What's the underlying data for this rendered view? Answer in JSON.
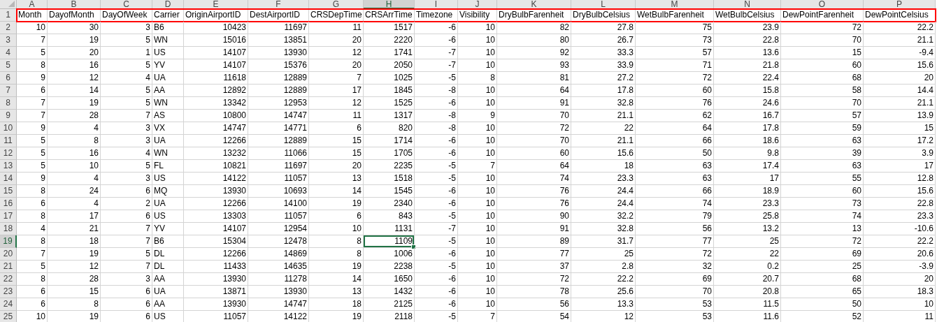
{
  "columns": [
    {
      "letter": "A",
      "kind": "number",
      "selected": false
    },
    {
      "letter": "B",
      "kind": "number",
      "selected": false
    },
    {
      "letter": "C",
      "kind": "number",
      "selected": false
    },
    {
      "letter": "D",
      "kind": "text",
      "selected": false
    },
    {
      "letter": "E",
      "kind": "number",
      "selected": false
    },
    {
      "letter": "F",
      "kind": "number",
      "selected": false
    },
    {
      "letter": "G",
      "kind": "number",
      "selected": false
    },
    {
      "letter": "H",
      "kind": "number",
      "selected": true
    },
    {
      "letter": "I",
      "kind": "number",
      "selected": false
    },
    {
      "letter": "J",
      "kind": "number",
      "selected": false
    },
    {
      "letter": "K",
      "kind": "number",
      "selected": false
    },
    {
      "letter": "L",
      "kind": "number",
      "selected": false
    },
    {
      "letter": "M",
      "kind": "number",
      "selected": false
    },
    {
      "letter": "N",
      "kind": "number",
      "selected": false
    },
    {
      "letter": "O",
      "kind": "number",
      "selected": false
    },
    {
      "letter": "P",
      "kind": "number",
      "selected": false
    }
  ],
  "rows": [
    {
      "number": "1",
      "kind": "header",
      "selected": false,
      "highlighted": true,
      "cells": [
        "Month",
        "DayofMonth",
        "DayOfWeek",
        "Carrier",
        "OriginAirportID",
        "DestAirportID",
        "CRSDepTime",
        "CRSArrTime",
        "Timezone",
        "Visibility",
        "DryBulbFarenheit",
        "DryBulbCelsius",
        "WetBulbFarenheit",
        "WetBulbCelsius",
        "DewPointFarenheit",
        "DewPointCelsius"
      ]
    },
    {
      "number": "2",
      "kind": "data",
      "selected": false,
      "highlighted": false,
      "cells": [
        "10",
        "30",
        "3",
        "B6",
        "10423",
        "11697",
        "11",
        "1517",
        "-6",
        "10",
        "82",
        "27.8",
        "75",
        "23.9",
        "72",
        "22.2"
      ]
    },
    {
      "number": "3",
      "kind": "data",
      "selected": false,
      "highlighted": false,
      "cells": [
        "7",
        "19",
        "5",
        "WN",
        "15016",
        "13851",
        "20",
        "2220",
        "-6",
        "10",
        "80",
        "26.7",
        "73",
        "22.8",
        "70",
        "21.1"
      ]
    },
    {
      "number": "4",
      "kind": "data",
      "selected": false,
      "highlighted": false,
      "cells": [
        "5",
        "20",
        "1",
        "US",
        "14107",
        "13930",
        "12",
        "1741",
        "-7",
        "10",
        "92",
        "33.3",
        "57",
        "13.6",
        "15",
        "-9.4"
      ]
    },
    {
      "number": "5",
      "kind": "data",
      "selected": false,
      "highlighted": false,
      "cells": [
        "8",
        "16",
        "5",
        "YV",
        "14107",
        "15376",
        "20",
        "2050",
        "-7",
        "10",
        "93",
        "33.9",
        "71",
        "21.8",
        "60",
        "15.6"
      ]
    },
    {
      "number": "6",
      "kind": "data",
      "selected": false,
      "highlighted": false,
      "cells": [
        "9",
        "12",
        "4",
        "UA",
        "11618",
        "12889",
        "7",
        "1025",
        "-5",
        "8",
        "81",
        "27.2",
        "72",
        "22.4",
        "68",
        "20"
      ]
    },
    {
      "number": "7",
      "kind": "data",
      "selected": false,
      "highlighted": false,
      "cells": [
        "6",
        "14",
        "5",
        "AA",
        "12892",
        "12889",
        "17",
        "1845",
        "-8",
        "10",
        "64",
        "17.8",
        "60",
        "15.8",
        "58",
        "14.4"
      ]
    },
    {
      "number": "8",
      "kind": "data",
      "selected": false,
      "highlighted": false,
      "cells": [
        "7",
        "19",
        "5",
        "WN",
        "13342",
        "12953",
        "12",
        "1525",
        "-6",
        "10",
        "91",
        "32.8",
        "76",
        "24.6",
        "70",
        "21.1"
      ]
    },
    {
      "number": "9",
      "kind": "data",
      "selected": false,
      "highlighted": false,
      "cells": [
        "7",
        "28",
        "7",
        "AS",
        "10800",
        "14747",
        "11",
        "1317",
        "-8",
        "9",
        "70",
        "21.1",
        "62",
        "16.7",
        "57",
        "13.9"
      ]
    },
    {
      "number": "10",
      "kind": "data",
      "selected": false,
      "highlighted": false,
      "cells": [
        "9",
        "4",
        "3",
        "VX",
        "14747",
        "14771",
        "6",
        "820",
        "-8",
        "10",
        "72",
        "22",
        "64",
        "17.8",
        "59",
        "15"
      ]
    },
    {
      "number": "11",
      "kind": "data",
      "selected": false,
      "highlighted": false,
      "cells": [
        "5",
        "8",
        "3",
        "UA",
        "12266",
        "12889",
        "15",
        "1714",
        "-6",
        "10",
        "70",
        "21.1",
        "66",
        "18.6",
        "63",
        "17.2"
      ]
    },
    {
      "number": "12",
      "kind": "data",
      "selected": false,
      "highlighted": false,
      "cells": [
        "5",
        "16",
        "4",
        "WN",
        "13232",
        "11066",
        "15",
        "1705",
        "-6",
        "10",
        "60",
        "15.6",
        "50",
        "9.8",
        "39",
        "3.9"
      ]
    },
    {
      "number": "13",
      "kind": "data",
      "selected": false,
      "highlighted": false,
      "cells": [
        "5",
        "10",
        "5",
        "FL",
        "10821",
        "11697",
        "20",
        "2235",
        "-5",
        "7",
        "64",
        "18",
        "63",
        "17.4",
        "63",
        "17"
      ]
    },
    {
      "number": "14",
      "kind": "data",
      "selected": false,
      "highlighted": false,
      "cells": [
        "9",
        "4",
        "3",
        "US",
        "14122",
        "11057",
        "13",
        "1518",
        "-5",
        "10",
        "74",
        "23.3",
        "63",
        "17",
        "55",
        "12.8"
      ]
    },
    {
      "number": "15",
      "kind": "data",
      "selected": false,
      "highlighted": false,
      "cells": [
        "8",
        "24",
        "6",
        "MQ",
        "13930",
        "10693",
        "14",
        "1545",
        "-6",
        "10",
        "76",
        "24.4",
        "66",
        "18.9",
        "60",
        "15.6"
      ]
    },
    {
      "number": "16",
      "kind": "data",
      "selected": false,
      "highlighted": false,
      "cells": [
        "6",
        "4",
        "2",
        "UA",
        "12266",
        "14100",
        "19",
        "2340",
        "-6",
        "10",
        "76",
        "24.4",
        "74",
        "23.3",
        "73",
        "22.8"
      ]
    },
    {
      "number": "17",
      "kind": "data",
      "selected": false,
      "highlighted": false,
      "cells": [
        "8",
        "17",
        "6",
        "US",
        "13303",
        "11057",
        "6",
        "843",
        "-5",
        "10",
        "90",
        "32.2",
        "79",
        "25.8",
        "74",
        "23.3"
      ]
    },
    {
      "number": "18",
      "kind": "data",
      "selected": false,
      "highlighted": false,
      "cells": [
        "4",
        "21",
        "7",
        "YV",
        "14107",
        "12954",
        "10",
        "1131",
        "-7",
        "10",
        "91",
        "32.8",
        "56",
        "13.2",
        "13",
        "-10.6"
      ]
    },
    {
      "number": "19",
      "kind": "data",
      "selected": true,
      "highlighted": false,
      "cells": [
        "8",
        "18",
        "7",
        "B6",
        "15304",
        "12478",
        "8",
        "1109",
        "-5",
        "10",
        "89",
        "31.7",
        "77",
        "25",
        "72",
        "22.2"
      ]
    },
    {
      "number": "20",
      "kind": "data",
      "selected": false,
      "highlighted": false,
      "cells": [
        "7",
        "19",
        "5",
        "DL",
        "12266",
        "14869",
        "8",
        "1006",
        "-6",
        "10",
        "77",
        "25",
        "72",
        "22",
        "69",
        "20.6"
      ]
    },
    {
      "number": "21",
      "kind": "data",
      "selected": false,
      "highlighted": false,
      "cells": [
        "5",
        "12",
        "7",
        "DL",
        "11433",
        "14635",
        "19",
        "2238",
        "-5",
        "10",
        "37",
        "2.8",
        "32",
        "0.2",
        "25",
        "-3.9"
      ]
    },
    {
      "number": "22",
      "kind": "data",
      "selected": false,
      "highlighted": false,
      "cells": [
        "8",
        "28",
        "3",
        "AA",
        "13930",
        "11278",
        "14",
        "1650",
        "-6",
        "10",
        "72",
        "22.2",
        "69",
        "20.7",
        "68",
        "20"
      ]
    },
    {
      "number": "23",
      "kind": "data",
      "selected": false,
      "highlighted": false,
      "cells": [
        "6",
        "15",
        "6",
        "UA",
        "13871",
        "13930",
        "13",
        "1432",
        "-6",
        "10",
        "78",
        "25.6",
        "70",
        "20.8",
        "65",
        "18.3"
      ]
    },
    {
      "number": "24",
      "kind": "data",
      "selected": false,
      "highlighted": false,
      "cells": [
        "6",
        "8",
        "6",
        "AA",
        "13930",
        "14747",
        "18",
        "2125",
        "-6",
        "10",
        "56",
        "13.3",
        "53",
        "11.5",
        "50",
        "10"
      ]
    },
    {
      "number": "25",
      "kind": "data",
      "selected": false,
      "highlighted": false,
      "cells": [
        "10",
        "19",
        "6",
        "US",
        "11057",
        "14122",
        "19",
        "2118",
        "-5",
        "7",
        "54",
        "12",
        "53",
        "11.6",
        "52",
        "11"
      ]
    }
  ]
}
